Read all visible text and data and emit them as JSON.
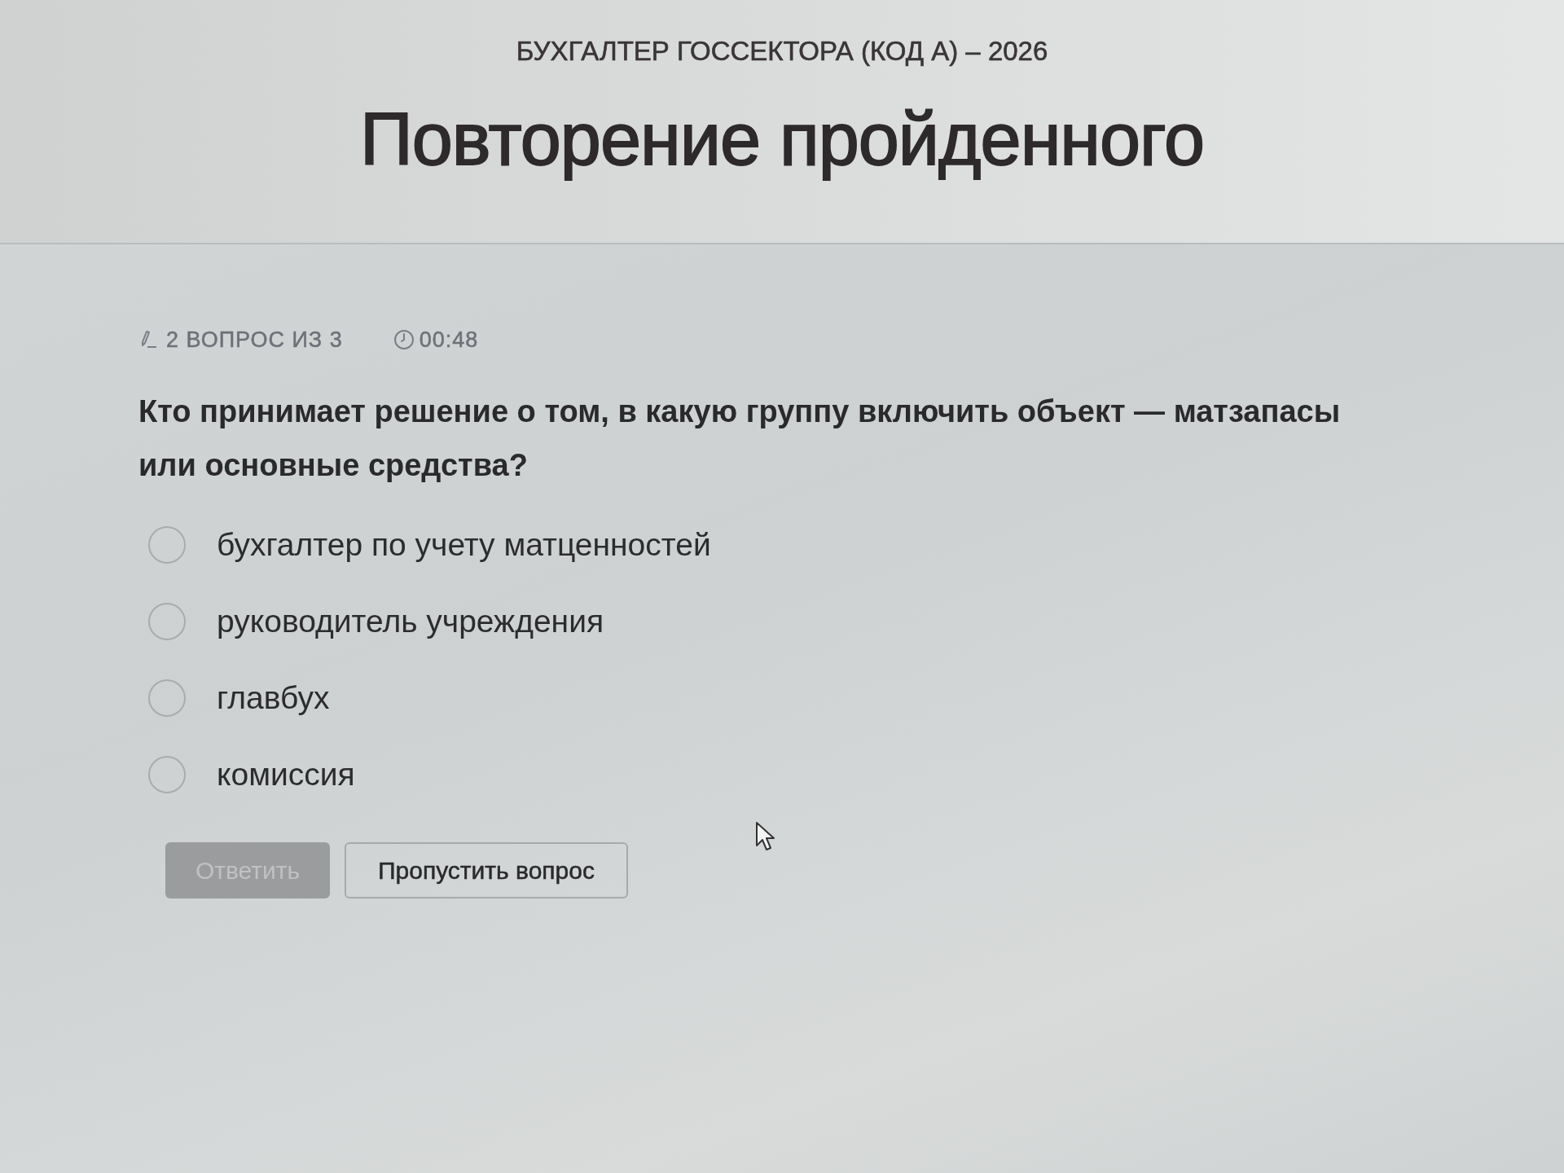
{
  "header": {
    "course": "БУХГАЛТЕР ГОССЕКТОРА (КОД А) – 2026",
    "title": "Повторение пройденного"
  },
  "quiz": {
    "progress": "2 ВОПРОС ИЗ 3",
    "timer": "00:48",
    "question": "Кто принимает решение о том, в какую группу включить объект — матзапасы или основные средства?",
    "options": [
      {
        "label": "бухгалтер по учету матценностей",
        "selected": false
      },
      {
        "label": "руководитель учреждения",
        "selected": false
      },
      {
        "label": "главбух",
        "selected": false
      },
      {
        "label": "комиссия",
        "selected": false
      }
    ]
  },
  "buttons": [
    {
      "label": "Ответить",
      "kind": "primary",
      "disabled": true
    },
    {
      "label": "Пропустить вопрос",
      "kind": "secondary",
      "disabled": false
    }
  ]
}
